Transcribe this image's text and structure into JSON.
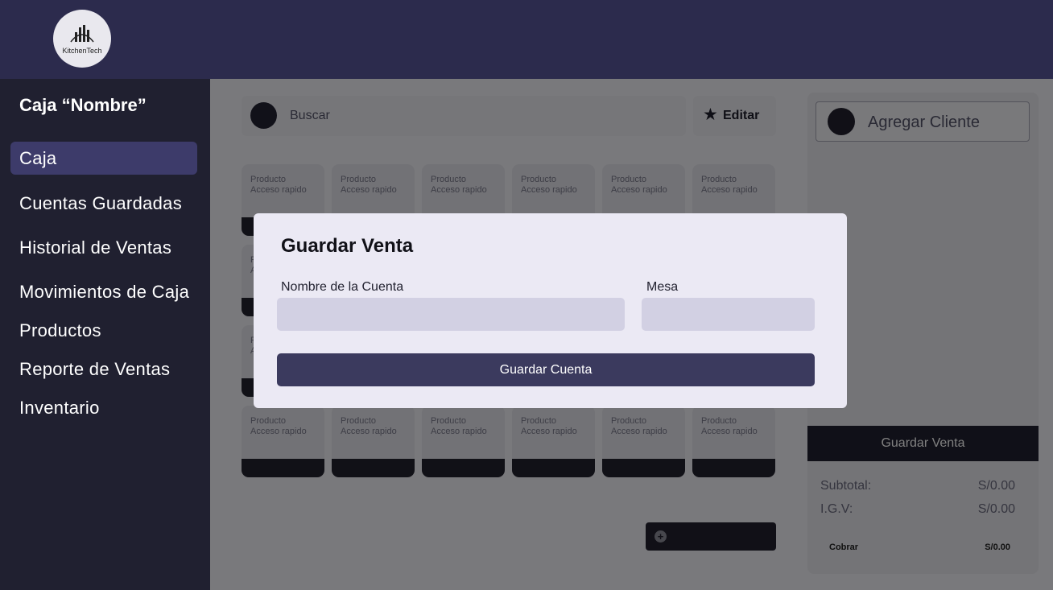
{
  "header": {
    "logo_text": "KitchenTech",
    "logo_icon": "kitchentech-logo-icon"
  },
  "sidebar": {
    "title": "Caja “Nombre”",
    "items": [
      {
        "label": "Caja",
        "active": true
      },
      {
        "label": "Cuentas Guardadas"
      },
      {
        "label": "Historial de Ventas"
      },
      {
        "label": "Movimientos de Caja"
      },
      {
        "label": "Productos"
      },
      {
        "label": "Reporte de Ventas"
      },
      {
        "label": "Inventario"
      }
    ]
  },
  "main": {
    "search_placeholder": "Buscar",
    "search_icon": "search-icon",
    "edit_label": "Editar",
    "edit_icon": "star-icon",
    "product_tile": {
      "line1": "Producto",
      "line2": "Acceso rapido"
    },
    "add_icon": "plus-circle-icon"
  },
  "right_panel": {
    "add_client_label": "Agregar Cliente",
    "save_sale_label": "Guardar Venta",
    "subtotal_label": "Subtotal:",
    "subtotal_value": "S/0.00",
    "igv_label": "I.G.V:",
    "igv_value": "S/0.00",
    "cobrar_label": "Cobrar",
    "cobrar_value": "S/0.00"
  },
  "modal": {
    "title": "Guardar Venta",
    "account_name_label": "Nombre de la Cuenta",
    "account_name_value": "",
    "table_label": "Mesa",
    "table_value": "",
    "save_button_label": "Guardar Cuenta"
  },
  "colors": {
    "header_bg": "#2c2b4d",
    "sidebar_bg": "#202030",
    "active_nav": "#3d3b6a",
    "primary_button": "#3b3a5e",
    "modal_bg": "#ebe9f4",
    "input_bg": "#d2d0e3"
  }
}
